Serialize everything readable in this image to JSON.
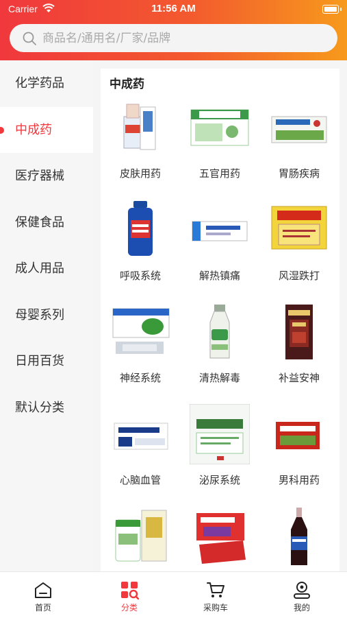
{
  "status_bar": {
    "carrier": "Carrier",
    "time": "11:56 AM"
  },
  "search": {
    "placeholder": "商品名/通用名/厂家/品牌"
  },
  "sidebar": {
    "items": [
      {
        "label": "化学药品",
        "active": false
      },
      {
        "label": "中成药",
        "active": true
      },
      {
        "label": "医疗器械",
        "active": false
      },
      {
        "label": "保健食品",
        "active": false
      },
      {
        "label": "成人用品",
        "active": false
      },
      {
        "label": "母婴系列",
        "active": false
      },
      {
        "label": "日用百货",
        "active": false
      },
      {
        "label": "默认分类",
        "active": false
      }
    ]
  },
  "panel": {
    "title": "中成药",
    "items": [
      {
        "label": "皮肤用药",
        "icon": "skin-medicine-product-icon"
      },
      {
        "label": "五官用药",
        "icon": "facial-medicine-product-icon"
      },
      {
        "label": "胃肠疾病",
        "icon": "gastro-medicine-product-icon"
      },
      {
        "label": "呼吸系统",
        "icon": "respiratory-medicine-product-icon"
      },
      {
        "label": "解热镇痛",
        "icon": "analgesic-product-icon"
      },
      {
        "label": "风湿跌打",
        "icon": "rheumatism-product-icon"
      },
      {
        "label": "神经系统",
        "icon": "nervous-system-product-icon"
      },
      {
        "label": "清热解毒",
        "icon": "detox-product-icon"
      },
      {
        "label": "补益安神",
        "icon": "tonic-product-icon"
      },
      {
        "label": "心脑血管",
        "icon": "cardio-product-icon"
      },
      {
        "label": "泌尿系统",
        "icon": "urinary-product-icon"
      },
      {
        "label": "男科用药",
        "icon": "andrology-product-icon"
      },
      {
        "label": "",
        "icon": "capsule-bottle-product-icon"
      },
      {
        "label": "",
        "icon": "granule-pack-product-icon"
      },
      {
        "label": "",
        "icon": "syrup-bottle-product-icon"
      }
    ]
  },
  "tabbar": {
    "items": [
      {
        "label": "首页",
        "icon": "home-icon",
        "active": false
      },
      {
        "label": "分类",
        "icon": "category-icon",
        "active": true
      },
      {
        "label": "采购车",
        "icon": "cart-icon",
        "active": false
      },
      {
        "label": "我的",
        "icon": "profile-icon",
        "active": false
      }
    ]
  },
  "colors": {
    "accent": "#f0383d",
    "gradient_end": "#f79a1c"
  }
}
